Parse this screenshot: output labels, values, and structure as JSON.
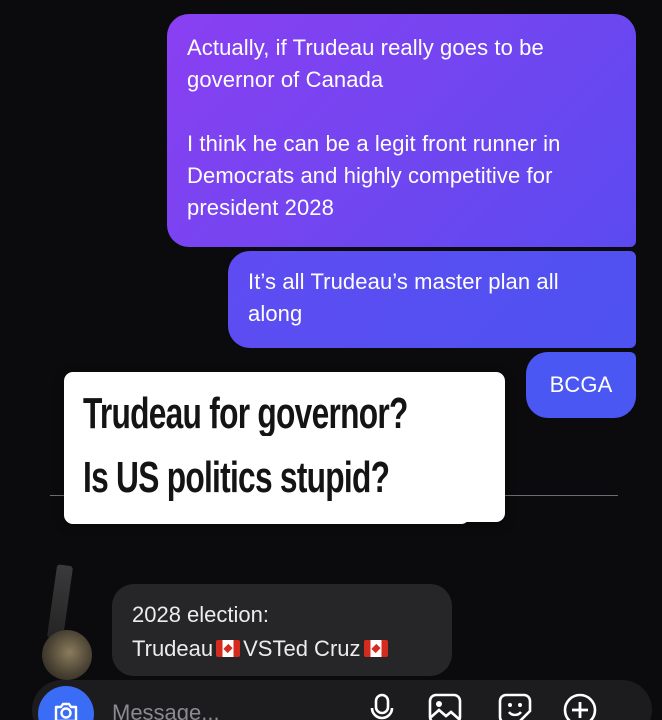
{
  "messages": {
    "out1": {
      "para1": "Actually, if Trudeau really goes to be governor of Canada",
      "para2": "I think he can be a legit front runner in Democrats and highly competitive for president 2028"
    },
    "out2": "It’s all Trudeau’s master plan all along",
    "out3": "BCGA",
    "in1": {
      "line1": "2028 election:",
      "name_a": "Trudeau",
      "vs": "VSTed Cruz"
    }
  },
  "overlay": {
    "line1": "Trudeau for governor?",
    "line2": "Is US politics stupid?"
  },
  "composer": {
    "placeholder": "Message..."
  },
  "icons": {
    "camera": "camera-icon",
    "mic": "microphone-icon",
    "gallery": "gallery-icon",
    "sticker": "sticker-icon",
    "plus": "plus-icon",
    "flag": "canada-flag-icon"
  },
  "colors": {
    "outgoing_start": "#8a3ff2",
    "outgoing_end": "#4b57f2",
    "incoming": "#262628",
    "camera_button": "#3b6cf6"
  }
}
